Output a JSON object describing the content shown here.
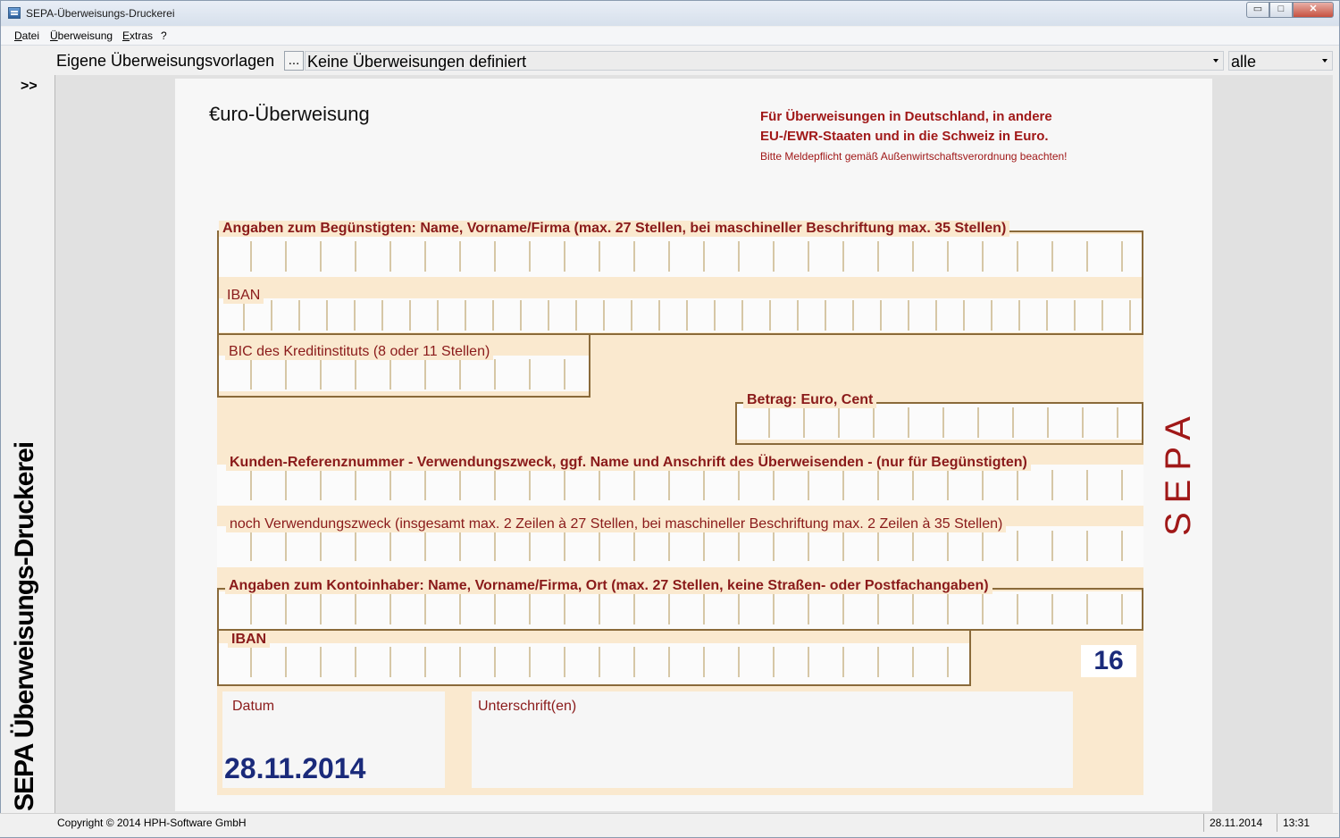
{
  "window": {
    "title": "SEPA-Überweisungs-Druckerei",
    "min_glyph": "▭",
    "max_glyph": "□",
    "close_glyph": "✕"
  },
  "menu": {
    "items": [
      "Datei",
      "Überweisung",
      "Extras",
      "?"
    ]
  },
  "toolbar": {
    "templates_label": "Eigene Überweisungsvorlagen",
    "browse_label": "...",
    "templates_value": "Keine Überweisungen definiert",
    "filter_value": "alle"
  },
  "side": {
    "toggle_label": ">>",
    "title": "SEPA Überweisungs-Druckerei"
  },
  "form": {
    "title": "€uro-Überweisung",
    "info_line1": "Für Überweisungen in Deutschland, in andere",
    "info_line2": "EU-/EWR-Staaten und in die Schweiz in Euro.",
    "info_line3": "Bitte Meldepflicht gemäß Außenwirtschaftsverordnung beachten!",
    "beneficiary_label": "Angaben zum Begünstigten: Name, Vorname/Firma (max. 27 Stellen, bei maschineller Beschriftung max. 35 Stellen)",
    "iban_label": "IBAN",
    "bic_label": "BIC des Kreditinstituts (8 oder 11 Stellen)",
    "amount_label": "Betrag: Euro, Cent",
    "reference_label": "Kunden-Referenznummer - Verwendungszweck, ggf. Name und Anschrift des Überweisenden - (nur für Begünstigten)",
    "purpose2_label": "noch Verwendungszweck (insgesamt max. 2 Zeilen à 27 Stellen, bei maschineller Beschriftung max. 2 Zeilen à 35 Stellen)",
    "holder_label": "Angaben zum Kontoinhaber: Name, Vorname/Firma, Ort (max. 27 Stellen, keine Straßen- oder Postfachangaben)",
    "holder_iban_label": "IBAN",
    "sepa_mark": "SEPA",
    "count": "16",
    "date_label": "Datum",
    "date_value": "28.11.2014",
    "signature_label": "Unterschrift(en)"
  },
  "status": {
    "copyright": "Copyright © 2014 HPH-Software GmbH",
    "date": "28.11.2014",
    "time": "13:31"
  }
}
